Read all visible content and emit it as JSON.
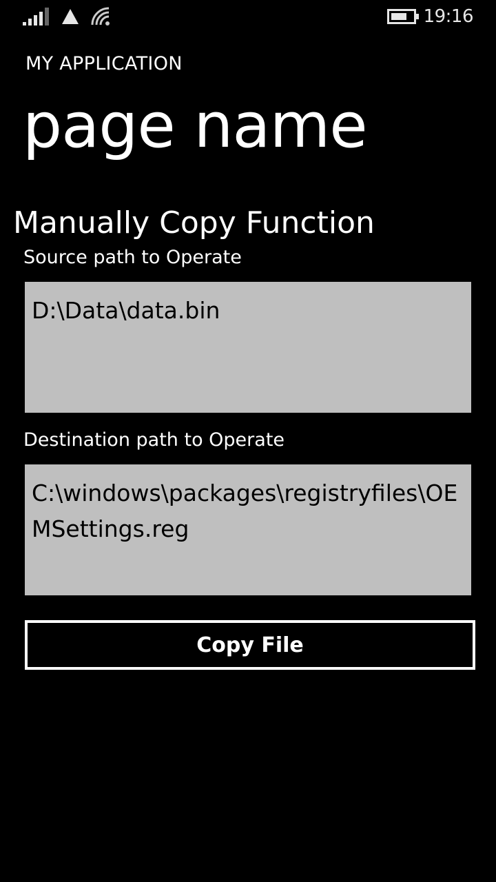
{
  "status_bar": {
    "time": "19:16",
    "icons": [
      "signal-strength-icon",
      "network-warning-icon",
      "wifi-icon",
      "battery-icon"
    ]
  },
  "app": {
    "title": "MY APPLICATION",
    "page_title": "page name"
  },
  "main": {
    "section_title": "Manually Copy Function",
    "source": {
      "label": "Source path to Operate",
      "value": "D:\\Data\\data.bin"
    },
    "destination": {
      "label": "Destination path to Operate",
      "value": "C:\\windows\\packages\\registryfiles\\OEMSettings.reg"
    },
    "copy_button_label": "Copy File"
  },
  "colors": {
    "background": "#000000",
    "text": "#ffffff",
    "textbox_background": "#bfbfbf",
    "textbox_text": "#000000"
  }
}
